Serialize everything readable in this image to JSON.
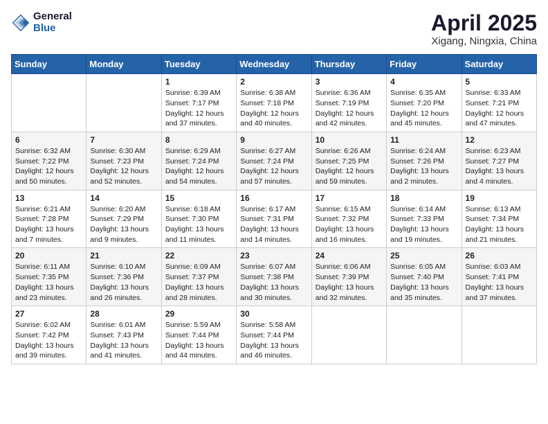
{
  "logo": {
    "general": "General",
    "blue": "Blue"
  },
  "title": "April 2025",
  "location": "Xigang, Ningxia, China",
  "weekdays": [
    "Sunday",
    "Monday",
    "Tuesday",
    "Wednesday",
    "Thursday",
    "Friday",
    "Saturday"
  ],
  "weeks": [
    [
      {
        "day": "",
        "info": ""
      },
      {
        "day": "",
        "info": ""
      },
      {
        "day": "1",
        "info": "Sunrise: 6:39 AM\nSunset: 7:17 PM\nDaylight: 12 hours and 37 minutes."
      },
      {
        "day": "2",
        "info": "Sunrise: 6:38 AM\nSunset: 7:18 PM\nDaylight: 12 hours and 40 minutes."
      },
      {
        "day": "3",
        "info": "Sunrise: 6:36 AM\nSunset: 7:19 PM\nDaylight: 12 hours and 42 minutes."
      },
      {
        "day": "4",
        "info": "Sunrise: 6:35 AM\nSunset: 7:20 PM\nDaylight: 12 hours and 45 minutes."
      },
      {
        "day": "5",
        "info": "Sunrise: 6:33 AM\nSunset: 7:21 PM\nDaylight: 12 hours and 47 minutes."
      }
    ],
    [
      {
        "day": "6",
        "info": "Sunrise: 6:32 AM\nSunset: 7:22 PM\nDaylight: 12 hours and 50 minutes."
      },
      {
        "day": "7",
        "info": "Sunrise: 6:30 AM\nSunset: 7:23 PM\nDaylight: 12 hours and 52 minutes."
      },
      {
        "day": "8",
        "info": "Sunrise: 6:29 AM\nSunset: 7:24 PM\nDaylight: 12 hours and 54 minutes."
      },
      {
        "day": "9",
        "info": "Sunrise: 6:27 AM\nSunset: 7:24 PM\nDaylight: 12 hours and 57 minutes."
      },
      {
        "day": "10",
        "info": "Sunrise: 6:26 AM\nSunset: 7:25 PM\nDaylight: 12 hours and 59 minutes."
      },
      {
        "day": "11",
        "info": "Sunrise: 6:24 AM\nSunset: 7:26 PM\nDaylight: 13 hours and 2 minutes."
      },
      {
        "day": "12",
        "info": "Sunrise: 6:23 AM\nSunset: 7:27 PM\nDaylight: 13 hours and 4 minutes."
      }
    ],
    [
      {
        "day": "13",
        "info": "Sunrise: 6:21 AM\nSunset: 7:28 PM\nDaylight: 13 hours and 7 minutes."
      },
      {
        "day": "14",
        "info": "Sunrise: 6:20 AM\nSunset: 7:29 PM\nDaylight: 13 hours and 9 minutes."
      },
      {
        "day": "15",
        "info": "Sunrise: 6:18 AM\nSunset: 7:30 PM\nDaylight: 13 hours and 11 minutes."
      },
      {
        "day": "16",
        "info": "Sunrise: 6:17 AM\nSunset: 7:31 PM\nDaylight: 13 hours and 14 minutes."
      },
      {
        "day": "17",
        "info": "Sunrise: 6:15 AM\nSunset: 7:32 PM\nDaylight: 13 hours and 16 minutes."
      },
      {
        "day": "18",
        "info": "Sunrise: 6:14 AM\nSunset: 7:33 PM\nDaylight: 13 hours and 19 minutes."
      },
      {
        "day": "19",
        "info": "Sunrise: 6:13 AM\nSunset: 7:34 PM\nDaylight: 13 hours and 21 minutes."
      }
    ],
    [
      {
        "day": "20",
        "info": "Sunrise: 6:11 AM\nSunset: 7:35 PM\nDaylight: 13 hours and 23 minutes."
      },
      {
        "day": "21",
        "info": "Sunrise: 6:10 AM\nSunset: 7:36 PM\nDaylight: 13 hours and 26 minutes."
      },
      {
        "day": "22",
        "info": "Sunrise: 6:09 AM\nSunset: 7:37 PM\nDaylight: 13 hours and 28 minutes."
      },
      {
        "day": "23",
        "info": "Sunrise: 6:07 AM\nSunset: 7:38 PM\nDaylight: 13 hours and 30 minutes."
      },
      {
        "day": "24",
        "info": "Sunrise: 6:06 AM\nSunset: 7:39 PM\nDaylight: 13 hours and 32 minutes."
      },
      {
        "day": "25",
        "info": "Sunrise: 6:05 AM\nSunset: 7:40 PM\nDaylight: 13 hours and 35 minutes."
      },
      {
        "day": "26",
        "info": "Sunrise: 6:03 AM\nSunset: 7:41 PM\nDaylight: 13 hours and 37 minutes."
      }
    ],
    [
      {
        "day": "27",
        "info": "Sunrise: 6:02 AM\nSunset: 7:42 PM\nDaylight: 13 hours and 39 minutes."
      },
      {
        "day": "28",
        "info": "Sunrise: 6:01 AM\nSunset: 7:43 PM\nDaylight: 13 hours and 41 minutes."
      },
      {
        "day": "29",
        "info": "Sunrise: 5:59 AM\nSunset: 7:44 PM\nDaylight: 13 hours and 44 minutes."
      },
      {
        "day": "30",
        "info": "Sunrise: 5:58 AM\nSunset: 7:44 PM\nDaylight: 13 hours and 46 minutes."
      },
      {
        "day": "",
        "info": ""
      },
      {
        "day": "",
        "info": ""
      },
      {
        "day": "",
        "info": ""
      }
    ]
  ]
}
